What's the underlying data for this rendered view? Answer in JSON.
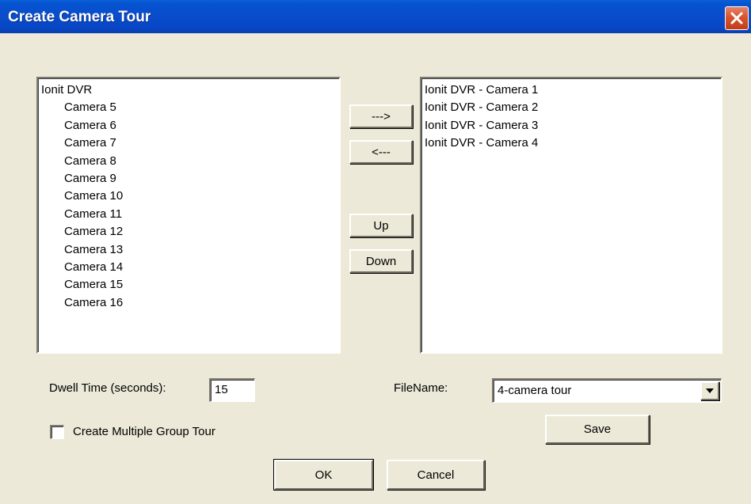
{
  "window": {
    "title": "Create Camera Tour",
    "close_icon": "close-icon",
    "close_color": "#d9542e",
    "titlebar_color": "#0a4ccb"
  },
  "available_list": {
    "root": "Ionit DVR",
    "items": [
      "Camera 5",
      "Camera 6",
      "Camera 7",
      "Camera 8",
      "Camera 9",
      "Camera 10",
      "Camera 11",
      "Camera 12",
      "Camera 13",
      "Camera 14",
      "Camera 15",
      "Camera 16"
    ]
  },
  "tour_list": {
    "items": [
      "Ionit DVR - Camera 1",
      "Ionit DVR - Camera 2",
      "Ionit DVR - Camera 3",
      "Ionit DVR - Camera 4"
    ]
  },
  "buttons": {
    "add": "--->",
    "remove": "<---",
    "up": "Up",
    "down": "Down",
    "save": "Save",
    "ok": "OK",
    "cancel": "Cancel"
  },
  "dwell": {
    "label": "Dwell Time (seconds):",
    "value": "15"
  },
  "filename": {
    "label": "FileName:",
    "value": "4-camera tour",
    "arrow_icon": "chevron-down-icon"
  },
  "multi_group": {
    "label": "Create Multiple Group Tour",
    "checked": false
  }
}
